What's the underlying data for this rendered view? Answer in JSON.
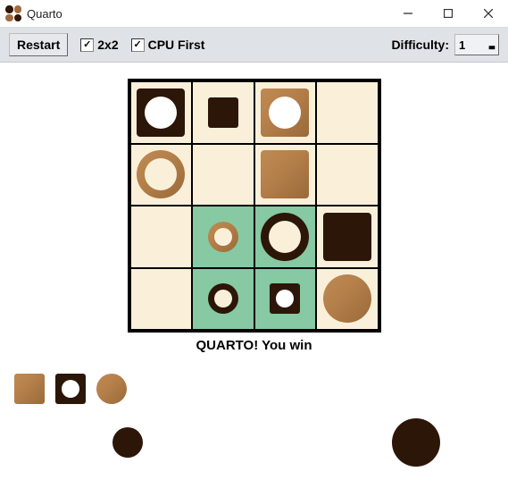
{
  "window": {
    "title": "Quarto"
  },
  "toolbar": {
    "restart_label": "Restart",
    "two_by_two_label": "2x2",
    "cpu_first_label": "CPU First",
    "difficulty_label": "Difficulty:",
    "difficulty_value": "1"
  },
  "status_text": "QUARTO! You win",
  "board": {
    "rows": 4,
    "cols": 4,
    "highlighted_cells": [
      [
        2,
        1
      ],
      [
        2,
        2
      ],
      [
        3,
        1
      ],
      [
        3,
        2
      ]
    ],
    "cells": [
      [
        {
          "color": "dark",
          "shape": "square",
          "size": "big",
          "hollow": true
        },
        {
          "color": "dark",
          "shape": "square",
          "size": "small",
          "hollow": false
        },
        {
          "color": "wood",
          "shape": "square",
          "size": "big",
          "hollow": true
        },
        null
      ],
      [
        {
          "color": "wood",
          "shape": "circle",
          "size": "big",
          "hollow": true,
          "ring": true
        },
        null,
        {
          "color": "wood",
          "shape": "square",
          "size": "big",
          "hollow": false
        },
        null
      ],
      [
        null,
        {
          "color": "wood",
          "shape": "circle",
          "size": "small",
          "hollow": true,
          "ring": true
        },
        {
          "color": "dark",
          "shape": "circle",
          "size": "big",
          "hollow": true,
          "ring": true
        },
        {
          "color": "dark",
          "shape": "square",
          "size": "big",
          "hollow": false
        }
      ],
      [
        null,
        {
          "color": "dark",
          "shape": "circle",
          "size": "small",
          "hollow": true,
          "ring": true
        },
        {
          "color": "dark",
          "shape": "square",
          "size": "small",
          "hollow": true
        },
        {
          "color": "wood",
          "shape": "circle",
          "size": "big",
          "hollow": false
        }
      ]
    ]
  },
  "pool": {
    "row1": [
      {
        "color": "wood",
        "shape": "square",
        "size": "small",
        "hollow": false
      },
      {
        "color": "dark",
        "shape": "square",
        "size": "small",
        "hollow": true
      },
      {
        "color": "wood",
        "shape": "circle",
        "size": "small",
        "hollow": false
      }
    ],
    "row2_left": [
      {
        "color": "dark",
        "shape": "circle",
        "size": "small",
        "hollow": false
      }
    ],
    "row2_right": [
      {
        "color": "dark",
        "shape": "circle",
        "size": "big",
        "hollow": false
      }
    ]
  },
  "colors": {
    "dark": "#2c1608",
    "wood": "#b17c46",
    "cell": "#faf0da",
    "highlight": "#86c9a3",
    "toolbar": "#dfe2e7"
  }
}
